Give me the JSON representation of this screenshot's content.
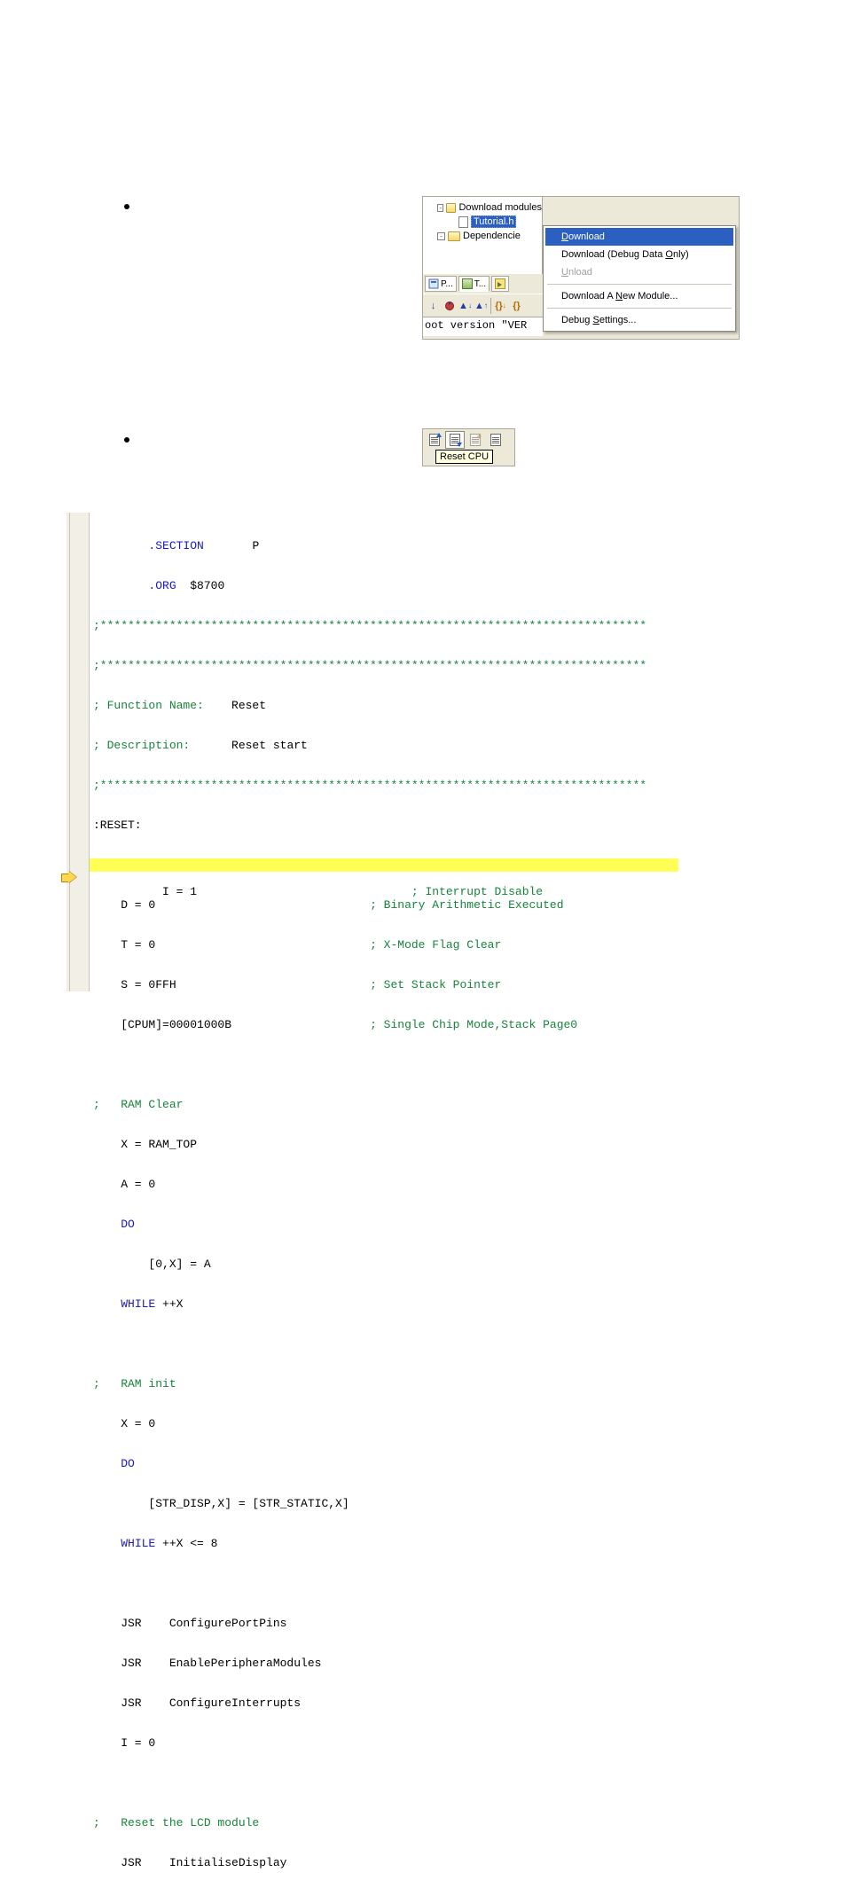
{
  "shot1": {
    "tree": {
      "root_label": "Download modules",
      "file_label": "Tutorial.h",
      "dep_label": "Dependencie"
    },
    "tabs": {
      "p": "P...",
      "t": "T..."
    },
    "output_text": "oot version \"VER",
    "menu": {
      "download": "Download",
      "download_ul": "D",
      "debugdata_pre": "Download (Debug Data ",
      "debugdata_ul": "O",
      "debugdata_post": "nly)",
      "unload_ul": "U",
      "unload_post": "nload",
      "newmod_pre": "Download A ",
      "newmod_ul": "N",
      "newmod_post": "ew Module...",
      "settings_pre": "Debug ",
      "settings_ul": "S",
      "settings_post": "ettings..."
    }
  },
  "shot2": {
    "tooltip": "Reset CPU"
  },
  "code": {
    "l01a": "        ",
    "l01b": ".SECTION",
    "l01c": "       P",
    "l02a": "        ",
    "l02b": ".ORG",
    "l02c": "  $8700",
    "stars": ";*******************************************************************************",
    "fn_a": "; Function Name:    ",
    "fn_b": "Reset",
    "ds_a": "; Description:      ",
    "ds_b": "Reset start",
    "reset_lbl": ":RESET:",
    "i1_a": "    I = 1                               ",
    "i1_b": "; Interrupt Disable",
    "d0_a": "    D = 0                               ",
    "d0_b": "; Binary Arithmetic Executed",
    "t0_a": "    T = 0                               ",
    "t0_b": "; X-Mode Flag Clear",
    "s_a": "    S = 0FFH                            ",
    "s_b": "; Set Stack Pointer",
    "cp_a": "    [CPUM]=00001000B                    ",
    "cp_b": "; Single Chip Mode,Stack Page0",
    "rc": ";   RAM Clear",
    "xr": "    X = RAM_TOP",
    "a0": "    A = 0",
    "do1": "    DO",
    "ox": "        [0,X] = A",
    "wh1a": "    ",
    "wh1b": "WHILE",
    "wh1c": " ++X",
    "ri": ";   RAM init",
    "x0": "    X = 0",
    "do2": "    DO",
    "str": "        [STR_DISP,X] = [STR_STATIC,X]",
    "wh2a": "    ",
    "wh2b": "WHILE",
    "wh2c": " ++X <= 8",
    "j1": "    JSR    ConfigurePortPins",
    "j2": "    JSR    EnablePeripheraModules",
    "j3": "    JSR    ConfigureInterrupts",
    "i0": "    I = 0",
    "rl": ";   Reset the LCD module",
    "j4": "    JSR    InitialiseDisplay"
  }
}
